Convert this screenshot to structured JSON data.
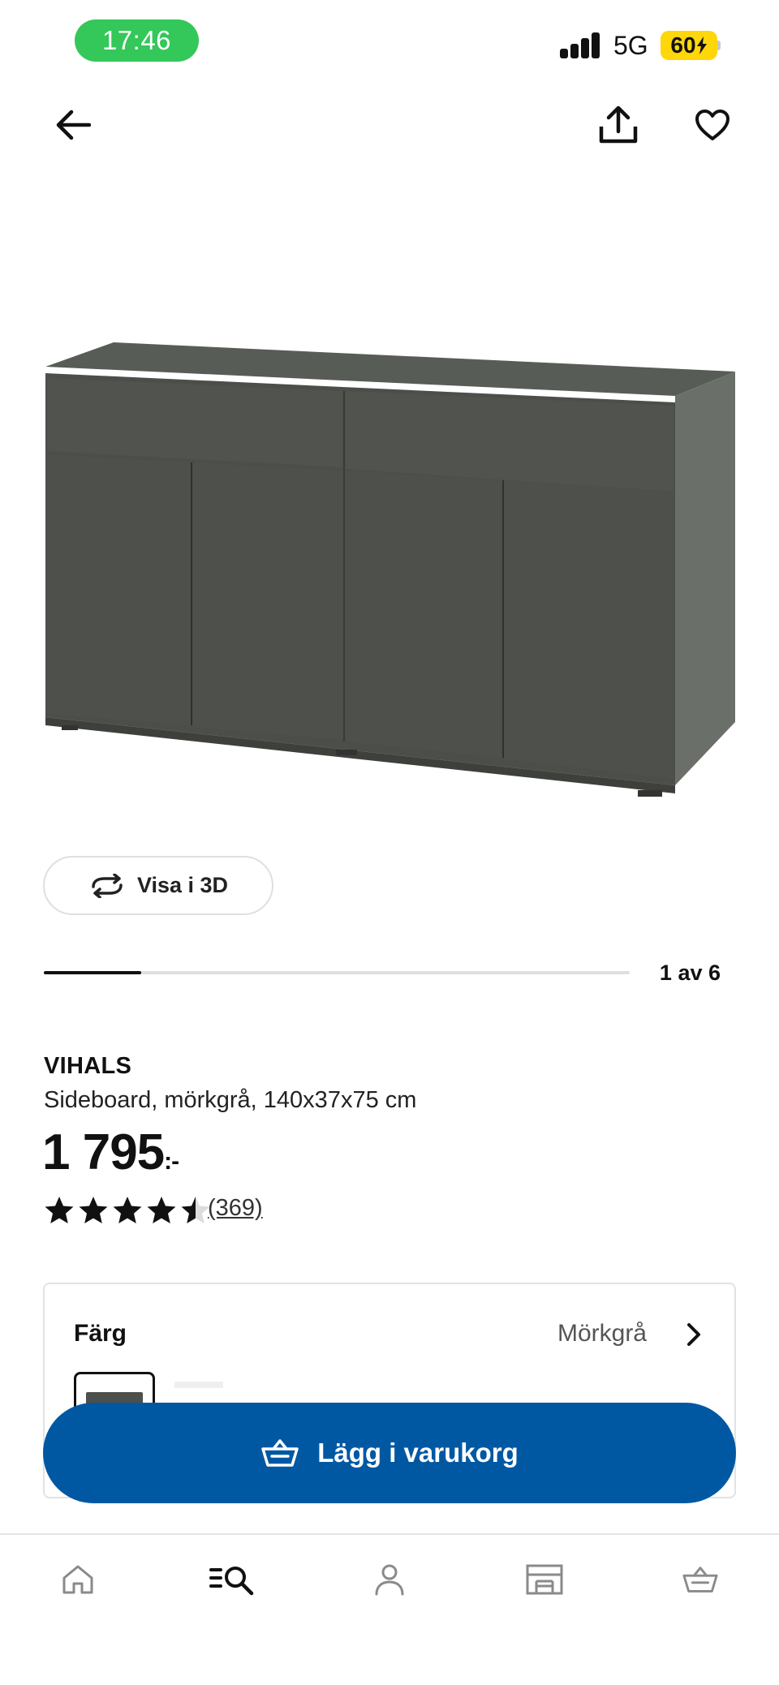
{
  "status_bar": {
    "time": "17:46",
    "network": "5G",
    "battery": "60"
  },
  "nav": {
    "back_icon": "arrow-left-icon",
    "share_icon": "share-icon",
    "favorite_icon": "heart-icon"
  },
  "product": {
    "image_label": "sideboard-product-image",
    "view3d_label": "Visa i 3D",
    "image_index": 1,
    "image_total": 6,
    "image_counter": "1 av 6",
    "name": "VIHALS",
    "description": "Sideboard, mörkgrå, 140x37x75 cm",
    "price": "1 795",
    "price_suffix": ":-",
    "rating": 4.5,
    "rating_max": 5,
    "review_count": "(369)"
  },
  "color_option": {
    "label": "Färg",
    "value": "Mörkgrå",
    "swatch_color": "#4c4f4a"
  },
  "cart": {
    "label": "Lägg i varukorg",
    "icon": "basket-icon"
  },
  "tabs": [
    {
      "name": "home",
      "icon": "home-icon"
    },
    {
      "name": "search",
      "icon": "search-list-icon"
    },
    {
      "name": "profile",
      "icon": "person-icon"
    },
    {
      "name": "store",
      "icon": "store-icon"
    },
    {
      "name": "cart",
      "icon": "basket-icon"
    }
  ],
  "colors": {
    "primary": "#0058a3",
    "time_pill": "#34c759",
    "battery": "#ffd60a",
    "text": "#111111",
    "muted": "#555555"
  }
}
